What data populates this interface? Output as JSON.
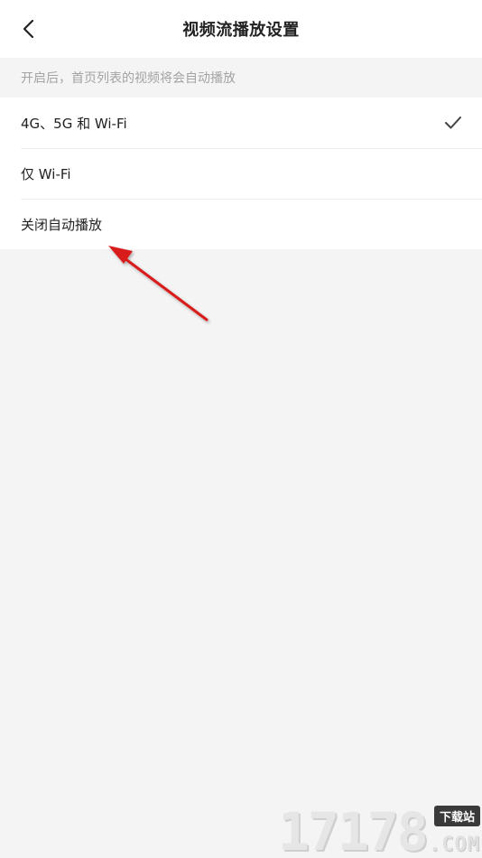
{
  "header": {
    "title": "视频流播放设置",
    "back_icon": "chevron-left-icon"
  },
  "hint": {
    "text": "开启后，首页列表的视频将会自动播放"
  },
  "options": [
    {
      "label": "4G、5G 和 Wi-Fi",
      "selected": true
    },
    {
      "label": "仅 Wi-Fi",
      "selected": false
    },
    {
      "label": "关闭自动播放",
      "selected": false
    }
  ],
  "colors": {
    "background": "#f4f4f4",
    "surface": "#ffffff",
    "text": "#222222",
    "hint_text": "#a3a3a3",
    "annotation_arrow": "#d81e1e"
  },
  "watermark": {
    "digits": "17178",
    "badge": "下载站",
    "suffix": ".COM"
  }
}
